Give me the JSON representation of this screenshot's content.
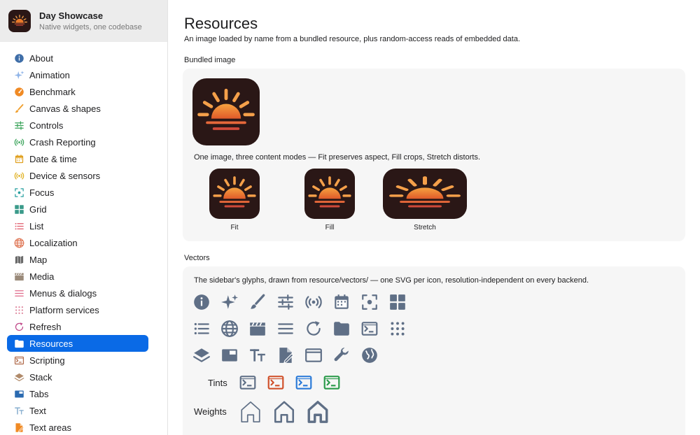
{
  "app": {
    "title": "Day Showcase",
    "subtitle": "Native widgets, one codebase"
  },
  "sidebar": {
    "items": [
      {
        "label": "About",
        "icon": "info-icon",
        "color": "#3f6ea8"
      },
      {
        "label": "Animation",
        "icon": "sparkles-icon",
        "color": "#8fb4e8"
      },
      {
        "label": "Benchmark",
        "icon": "gauge-icon",
        "color": "#f08a24"
      },
      {
        "label": "Canvas & shapes",
        "icon": "brush-icon",
        "color": "#f0a030"
      },
      {
        "label": "Controls",
        "icon": "sliders-icon",
        "color": "#3aa35a"
      },
      {
        "label": "Crash Reporting",
        "icon": "broadcast-icon",
        "color": "#3aa35a"
      },
      {
        "label": "Date & time",
        "icon": "calendar-icon",
        "color": "#e0a020"
      },
      {
        "label": "Device & sensors",
        "icon": "broadcast-icon",
        "color": "#e0b020"
      },
      {
        "label": "Focus",
        "icon": "focus-icon",
        "color": "#2aa0a0"
      },
      {
        "label": "Grid",
        "icon": "grid-icon",
        "color": "#3a9a8a"
      },
      {
        "label": "List",
        "icon": "list-icon",
        "color": "#e05a6a"
      },
      {
        "label": "Localization",
        "icon": "globe-icon",
        "color": "#e07a5a"
      },
      {
        "label": "Map",
        "icon": "map-icon",
        "color": "#6a6a6a"
      },
      {
        "label": "Media",
        "icon": "clapper-icon",
        "color": "#9a8a7a"
      },
      {
        "label": "Menus & dialogs",
        "icon": "menu-icon",
        "color": "#e06a8a"
      },
      {
        "label": "Platform services",
        "icon": "dots-grid-icon",
        "color": "#e08aa0"
      },
      {
        "label": "Refresh",
        "icon": "refresh-icon",
        "color": "#c04a8a"
      },
      {
        "label": "Resources",
        "icon": "folder-icon",
        "color": "#ffffff",
        "selected": true
      },
      {
        "label": "Scripting",
        "icon": "terminal-icon",
        "color": "#b06a4a"
      },
      {
        "label": "Stack",
        "icon": "layers-icon",
        "color": "#b08a6a"
      },
      {
        "label": "Tabs",
        "icon": "tabs-icon",
        "color": "#2a6ab0"
      },
      {
        "label": "Text",
        "icon": "text-size-icon",
        "color": "#8ab0d0"
      },
      {
        "label": "Text areas",
        "icon": "document-edit-icon",
        "color": "#f08a24"
      }
    ]
  },
  "page": {
    "title": "Resources",
    "description": "An image loaded by name from a bundled resource, plus random-access reads of embedded data."
  },
  "bundled": {
    "section": "Bundled image",
    "caption": "One image, three content modes — Fit preserves aspect, Fill crops, Stretch distorts.",
    "modes": [
      "Fit",
      "Fill",
      "Stretch"
    ]
  },
  "vectors": {
    "section": "Vectors",
    "caption": "The sidebar's glyphs, drawn from resource/vectors/ — one SVG per icon, resolution-independent on every backend.",
    "glyph_color": "#5f6f86",
    "rows": [
      [
        "info-icon",
        "sparkles-icon",
        "brush-icon",
        "sliders-icon",
        "broadcast-icon",
        "calendar-icon",
        "focus-icon",
        "grid-icon"
      ],
      [
        "list-icon",
        "globe-icon",
        "clapper-icon",
        "menu-icon",
        "refresh-icon",
        "folder-icon",
        "terminal-icon",
        "dots-grid-icon"
      ],
      [
        "layers-icon",
        "tabs-icon",
        "text-size-icon",
        "document-edit-icon",
        "window-icon",
        "wrench-icon",
        "globe-filled-icon"
      ]
    ],
    "tints_label": "Tints",
    "tints": [
      "#5f6f86",
      "#d0502a",
      "#2a7ad8",
      "#2a9a4a"
    ],
    "weights_label": "Weights",
    "weights": [
      2,
      3,
      4
    ]
  }
}
